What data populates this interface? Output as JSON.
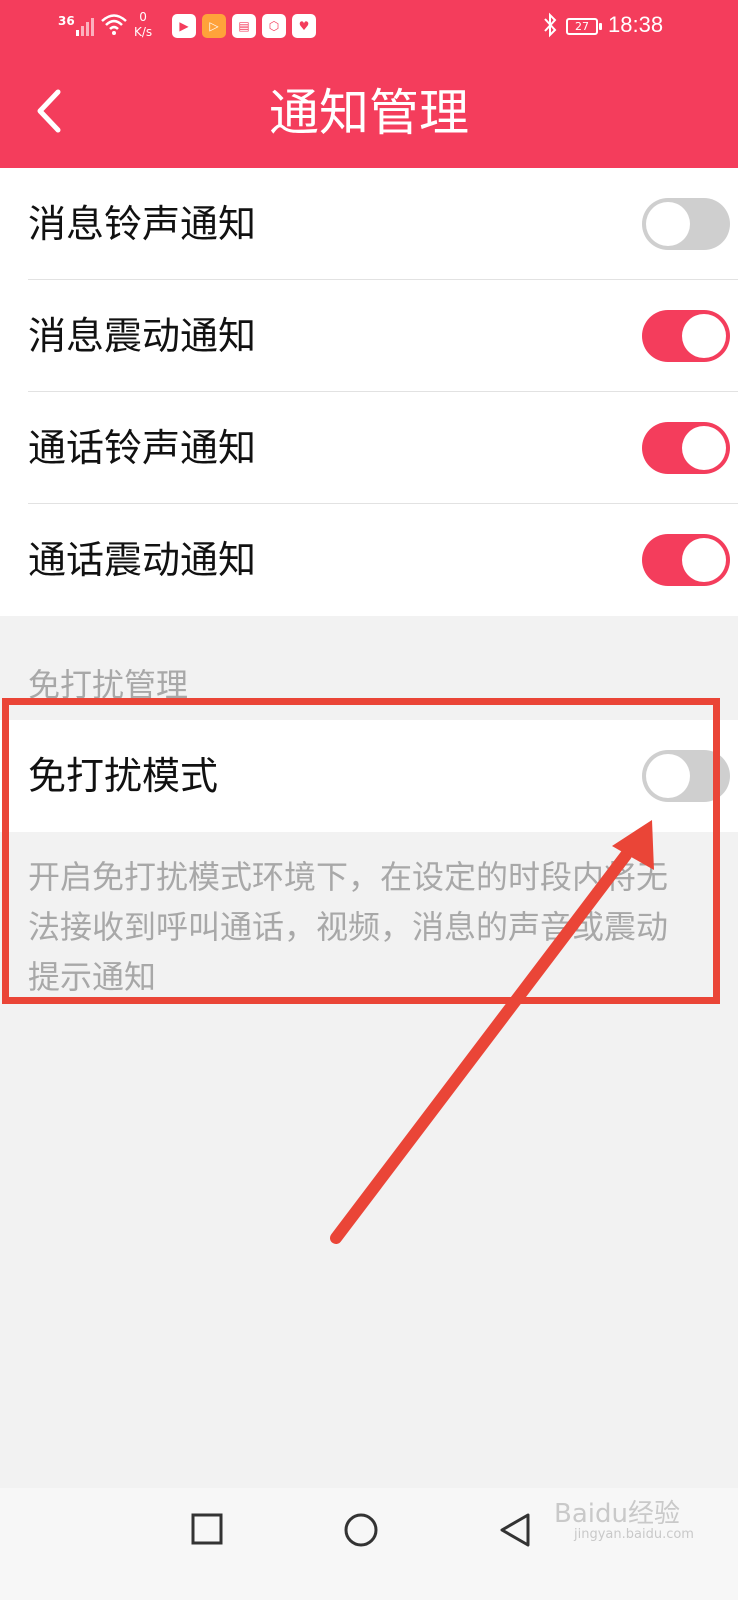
{
  "status_bar": {
    "signal": "36",
    "net_speed_value": "0",
    "net_speed_unit": "K/s",
    "app_icons": [
      "youku-icon",
      "video-icon",
      "book-icon",
      "shield-icon",
      "heart-icon"
    ],
    "battery": "27",
    "time": "18:38"
  },
  "header": {
    "title": "通知管理"
  },
  "settings": [
    {
      "label": "消息铃声通知",
      "on": false
    },
    {
      "label": "消息震动通知",
      "on": true
    },
    {
      "label": "通话铃声通知",
      "on": true
    },
    {
      "label": "通话震动通知",
      "on": true
    }
  ],
  "dnd": {
    "section_title": "免打扰管理",
    "label": "免打扰模式",
    "on": false,
    "description": "开启免打扰模式环境下，在设定的时段内将无法接收到呼叫通话，视频，消息的声音或震动提示通知"
  },
  "watermark": {
    "brand": "Baidu经验",
    "url": "jingyan.baidu.com"
  },
  "colors": {
    "accent": "#f43d5c",
    "toggle_off": "#cfcfcf",
    "annotation": "#ea4537"
  }
}
